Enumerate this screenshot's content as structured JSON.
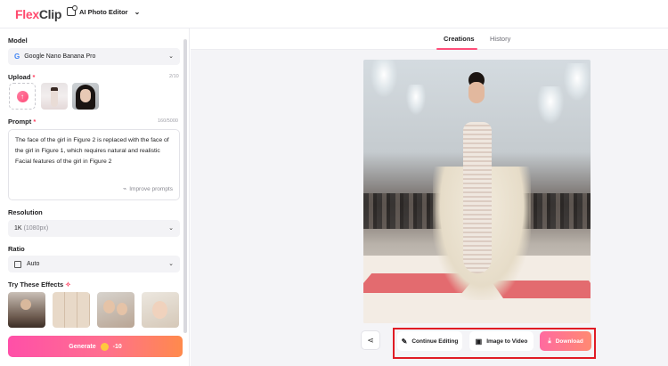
{
  "header": {
    "logo_part1": "Flex",
    "logo_part2": "Clip",
    "tool_name": "AI Photo Editor",
    "tool_chevron": "⌄"
  },
  "left_panel": {
    "model_label": "Model",
    "model_value": "Google Nano Banana Pro",
    "upload_label": "Upload",
    "upload_required": "*",
    "upload_count": "2/10",
    "prompt_label": "Prompt",
    "prompt_required": "*",
    "prompt_count": "160/5000",
    "prompt_text": "The face of the girl in Figure 2 is replaced with the face of the girl in Figure 1, which requires natural and realistic Facial features of the girl in Figure 2",
    "improve_label": "Improve prompts",
    "resolution_label": "Resolution",
    "resolution_value": "1K",
    "resolution_detail": "(1080px)",
    "ratio_label": "Ratio",
    "ratio_value": "Auto",
    "effects_label": "Try These Effects",
    "generate_label": "Generate",
    "generate_cost": "-10"
  },
  "tabs": {
    "creations": "Creations",
    "history": "History"
  },
  "actions": {
    "continue_editing": "Continue Editing",
    "image_to_video": "Image to Video",
    "download": "Download"
  },
  "colors": {
    "accent": "#ff4d79",
    "highlight_box": "#e01b24",
    "generate_gradient_start": "#ff4fa8",
    "generate_gradient_end": "#ff8a4c"
  }
}
